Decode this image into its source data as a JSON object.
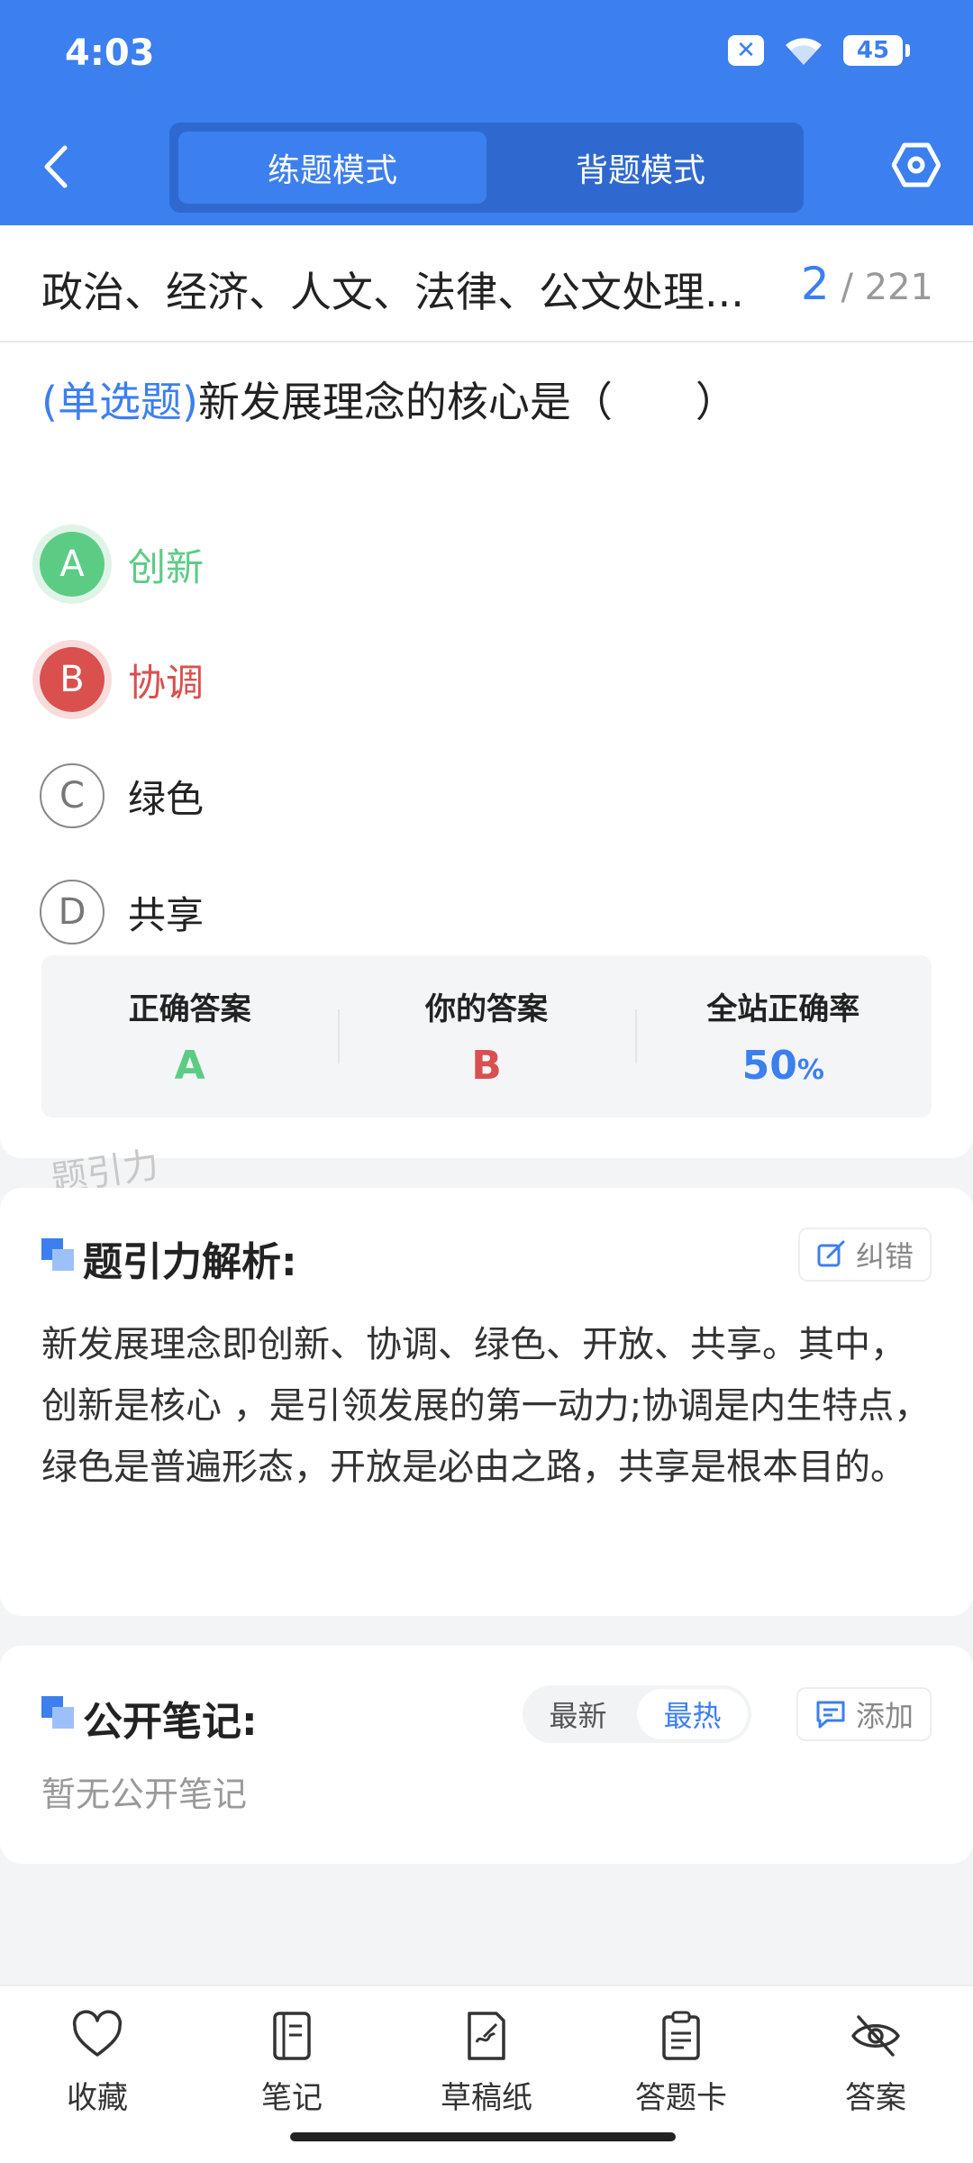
{
  "status_bar": {
    "time": "4:03",
    "battery": "45",
    "icons": [
      "sim-off-icon",
      "wifi-icon",
      "battery-icon"
    ]
  },
  "header": {
    "back_icon": "back-arrow-icon",
    "tabs": [
      {
        "label": "练题模式",
        "active": true
      },
      {
        "label": "背题模式",
        "active": false
      }
    ],
    "settings_icon": "settings-hexagon-icon"
  },
  "question_card": {
    "chapter_title": "政治、经济、人文、法律、公文处理...",
    "current_index": "2",
    "separator": "/",
    "total": "221",
    "question_type": "(单选题)",
    "question_text": "新发展理念的核心是（　　）",
    "options": [
      {
        "letter": "A",
        "text": "创新",
        "state": "correct"
      },
      {
        "letter": "B",
        "text": "协调",
        "state": "wrong"
      },
      {
        "letter": "C",
        "text": "绿色",
        "state": "normal"
      },
      {
        "letter": "D",
        "text": "共享",
        "state": "normal"
      }
    ],
    "result": {
      "correct_label": "正确答案",
      "correct_value": "A",
      "mine_label": "你的答案",
      "mine_value": "B",
      "rate_label": "全站正确率",
      "rate_value": "50",
      "rate_unit": "%"
    }
  },
  "watermark": "题引力",
  "analysis": {
    "title": "题引力解析:",
    "report_button": "纠错",
    "text": "新发展理念即创新、协调、绿色、开放、共享。其中， 创新是核心 ，是引领发展的第一动力;协调是内生特点，绿色是普遍形态，开放是必由之路，共享是根本目的。"
  },
  "notes": {
    "title": "公开笔记:",
    "sort_options": [
      {
        "label": "最新",
        "active": false
      },
      {
        "label": "最热",
        "active": true
      }
    ],
    "add_button": "添加",
    "empty_text": "暂无公开笔记"
  },
  "bottom_nav": [
    {
      "label": "收藏",
      "icon": "heart-icon"
    },
    {
      "label": "笔记",
      "icon": "notebook-icon"
    },
    {
      "label": "草稿纸",
      "icon": "draft-paper-icon"
    },
    {
      "label": "答题卡",
      "icon": "answer-sheet-icon"
    },
    {
      "label": "答案",
      "icon": "eye-off-icon"
    }
  ],
  "colors": {
    "primary": "#3c7fef",
    "correct": "#5ccc85",
    "wrong": "#d9504f"
  }
}
